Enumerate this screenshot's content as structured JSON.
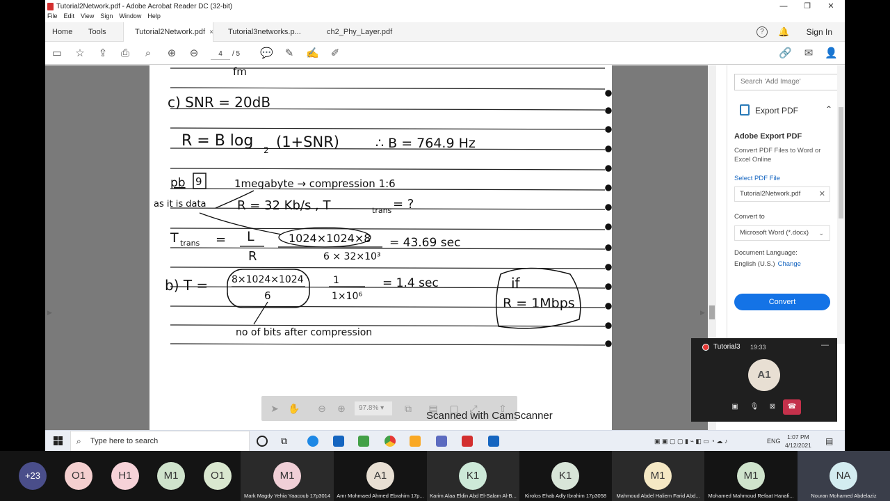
{
  "window": {
    "title": "Tutorial2Network.pdf - Adobe Acrobat Reader DC (32-bit)",
    "minimize": "—",
    "maximize": "❐",
    "close": "✕"
  },
  "menu": [
    "File",
    "Edit",
    "View",
    "Sign",
    "Window",
    "Help"
  ],
  "nav": {
    "home": "Home",
    "tools": "Tools",
    "sign_in": "Sign In"
  },
  "tabs": [
    {
      "label": "Tutorial2Network.pdf",
      "close": "×"
    },
    {
      "label": "Tutorial3networks.p..."
    },
    {
      "label": "ch2_Phy_Layer.pdf"
    }
  ],
  "toolbar": {
    "page_current": "4",
    "page_total": "/ 5"
  },
  "handwriting": {
    "line1": "fm",
    "line2": "c) SNR = 20dB",
    "line3a": "R = B log",
    "line3b": "2",
    "line3c": "(1+SNR)",
    "line3d": "∴ B = 764.9 Hz",
    "line4a": "pb",
    "line4b": "9",
    "line4c": "1megabyte → compression 1:6",
    "line5a": "as it is data",
    "line5b": "R = 32 Kb/s , T",
    "line5c": "trans",
    "line5d": " = ?",
    "line6a": "T",
    "line6b": "trans",
    "line6c": " = ",
    "line6d": "L",
    "line6e": "R",
    "line6f": "1024×1024×8",
    "line6g": "6 × 32×10³",
    "line6h": "= 43.69 sec",
    "line7a": "b) T = ",
    "line7b": "8×1024×1024",
    "line7c": "6",
    "line7d": "1",
    "line7e": "1×10⁶",
    "line7f": "= 1.4 sec",
    "line7g": "if",
    "line7h": "R = 1Mbps",
    "line8": "no of bits after compression"
  },
  "floatbar": {
    "zoom": "97.8%"
  },
  "watermark": "Scanned with CamScanner",
  "right_pane": {
    "search_placeholder": "Search 'Add Image'",
    "export_header": "Export PDF",
    "export_title": "Adobe Export PDF",
    "export_desc": "Convert PDF Files to Word or Excel Online",
    "select_link": "Select PDF File",
    "file_name": "Tutorial2Network.pdf",
    "convert_to_label": "Convert to",
    "convert_to_value": "Microsoft Word (*.docx)",
    "doc_lang_label": "Document Language:",
    "doc_lang_value": "English (U.S.)",
    "doc_lang_change": "Change",
    "convert_button": "Convert"
  },
  "call": {
    "title": "Tutorial3",
    "time": "19:33",
    "avatar": "A1"
  },
  "taskbar": {
    "search_placeholder": "Type here to search",
    "lang": "ENG",
    "time": "1:07 PM",
    "date": "4/12/2021"
  },
  "participants": [
    {
      "initials": "+23",
      "color": "#4a4e8a",
      "name": ""
    },
    {
      "initials": "O1",
      "color": "#f4cfcf",
      "name": ""
    },
    {
      "initials": "H1",
      "color": "#f6d2d8",
      "name": ""
    },
    {
      "initials": "M1",
      "color": "#cfe3cc",
      "name": ""
    },
    {
      "initials": "O1",
      "color": "#d9e7cf",
      "name": ""
    },
    {
      "initials": "M1",
      "color": "#f0cfd6",
      "name": "Mark Magdy Yehia Yaacoub 17p3014"
    },
    {
      "initials": "A1",
      "color": "#e8dfd3",
      "name": "Amr Mohmaed Ahmed Ebrahim 17p..."
    },
    {
      "initials": "K1",
      "color": "#cde9d8",
      "name": "Karim Alaa Eldin Abd El-Salam Al-B..."
    },
    {
      "initials": "K1",
      "color": "#d8e5d8",
      "name": "Kirolos Ehab Adly Ibrahim 17p3058"
    },
    {
      "initials": "M1",
      "color": "#f5e8c4",
      "name": "Mahmoud Abdel Haliem Farid Abd..."
    },
    {
      "initials": "M1",
      "color": "#cfe3cc",
      "name": "Mohamed Mahmoud Refaat Hanafi..."
    },
    {
      "initials": "NA",
      "color": "#d3ecf0",
      "name": "Nouran Mohamed Abdelaziz"
    }
  ],
  "colors": {
    "accent": "#1473e6",
    "hangup": "#c4314b",
    "pdf_red": "#d32f2f"
  }
}
